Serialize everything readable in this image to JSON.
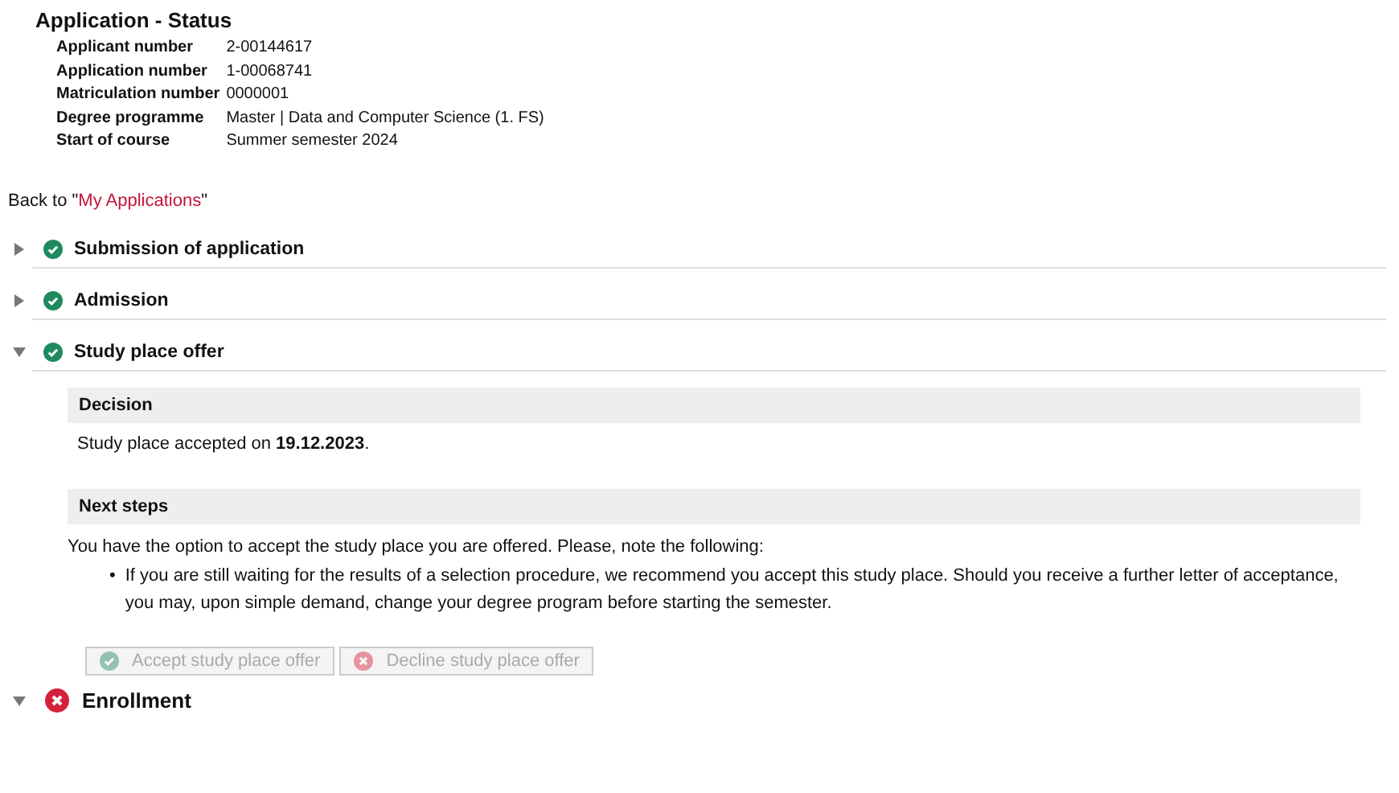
{
  "title": "Application - Status",
  "info": [
    {
      "label": "Applicant number",
      "value": "2-00144617"
    },
    {
      "label": "Application number",
      "value": "1-00068741"
    },
    {
      "label": "Matriculation number",
      "value": "0000001"
    },
    {
      "label": "Degree programme",
      "value": "Master | Data and Computer Science (1. FS)"
    },
    {
      "label": "Start of course",
      "value": "Summer semester 2024"
    }
  ],
  "back": {
    "prefix": "Back to \"",
    "link": "My Applications",
    "suffix": "\""
  },
  "sections": [
    {
      "title": "Submission of application",
      "kind": "done",
      "expanded": false,
      "large": false
    },
    {
      "title": "Admission",
      "kind": "done",
      "expanded": false,
      "large": false
    },
    {
      "title": "Study place offer",
      "kind": "done",
      "expanded": true,
      "large": false,
      "decision": {
        "heading": "Decision",
        "text": "Study place accepted on **19.12.2023**."
      },
      "next_steps": {
        "heading": "Next steps",
        "intro": "You have the option to accept the study place you are offered. Please, note the following:",
        "bullet_marker": "•",
        "bullets": [
          "If you are still waiting for the results of a selection procedure, we recommend you accept this study place. Should you receive a further letter of acceptance, you may, upon simple demand, change your degree program before starting the semester."
        ]
      },
      "buttons": [
        {
          "label": "Accept study place offer",
          "kind": "accept",
          "disabled": true
        },
        {
          "label": "Decline study place offer",
          "kind": "decline",
          "disabled": true
        }
      ]
    },
    {
      "title": "Enrollment",
      "kind": "failed",
      "expanded": true,
      "large": true
    }
  ]
}
